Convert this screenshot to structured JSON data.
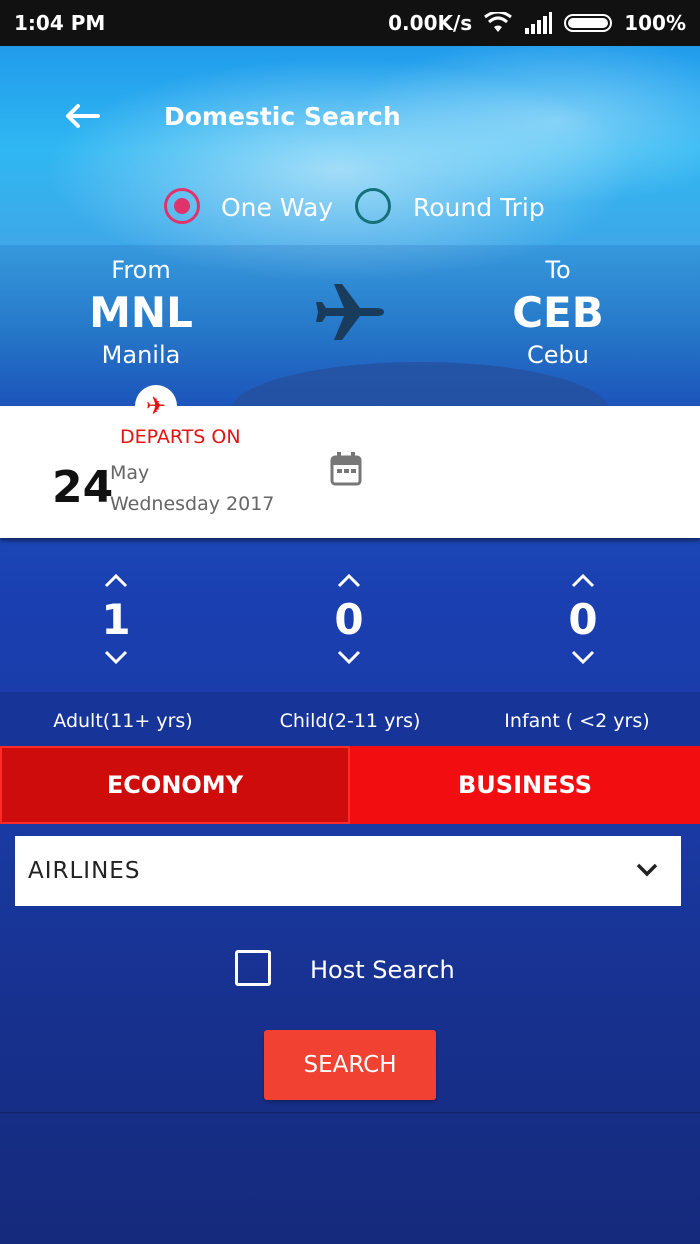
{
  "status_bar": {
    "time": "1:04 PM",
    "network_speed": "0.00K/s",
    "battery": "100%",
    "icons": [
      "wifi-icon",
      "signal-icon",
      "battery-icon"
    ]
  },
  "header": {
    "title": "Domestic Search",
    "back_icon": "back-arrow-icon"
  },
  "trip_type": {
    "options": [
      {
        "label": "One Way",
        "selected": true
      },
      {
        "label": "Round Trip",
        "selected": false
      }
    ]
  },
  "route": {
    "from": {
      "label": "From",
      "code": "MNL",
      "city": "Manila"
    },
    "to": {
      "label": "To",
      "code": "CEB",
      "city": "Cebu"
    },
    "icon": "plane-icon"
  },
  "departure": {
    "label": "DEPARTS ON",
    "day": "24",
    "month": "May",
    "weekday_year": "Wednesday 2017",
    "calendar_icon": "calendar-icon"
  },
  "passengers": {
    "adult": {
      "count": "1",
      "label": "Adult(11+ yrs)"
    },
    "child": {
      "count": "0",
      "label": "Child(2-11 yrs)"
    },
    "infant": {
      "count": "0",
      "label": "Infant ( <2 yrs)"
    }
  },
  "cabin_class": {
    "economy": "ECONOMY",
    "business": "BUSINESS",
    "selected": "ECONOMY"
  },
  "airlines_select": {
    "value": "AIRLINES"
  },
  "host_search": {
    "label": "Host Search",
    "checked": false
  },
  "search_button": {
    "label": "SEARCH"
  },
  "colors": {
    "accent_red": "#f20d11",
    "radio_pink": "#e0336c",
    "search_red": "#f04133"
  }
}
